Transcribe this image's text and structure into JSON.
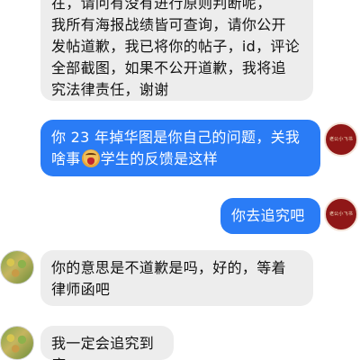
{
  "messages": [
    {
      "id": "m1",
      "direction": "incoming",
      "lines": [
        "所有海报战绩皆可查询，请你公开",
        "发帖道歉，我已将你的帖子，id，评论",
        "全部截图，如果不公开道歉，我将追",
        "究法律责任，谢谢"
      ],
      "cut_top_line": "在，请问有没有进行原则判断呢，",
      "prefix": "我"
    },
    {
      "id": "m2",
      "direction": "outgoing",
      "line1": "你 23 年掉华图是你自己的问题，关我",
      "line2_before_emoji": "啥事",
      "emoji": "angry-face-icon",
      "line2_after_emoji": "学生的反馈是这样"
    },
    {
      "id": "m3",
      "direction": "outgoing",
      "text": "你去追究吧"
    },
    {
      "id": "m4",
      "direction": "incoming",
      "line1": "你的意思是不道歉是吗，好的，等着",
      "line2": "律师函吧"
    },
    {
      "id": "m5",
      "direction": "incoming",
      "text": "我一定会追究到底"
    }
  ],
  "avatars": {
    "self_label": "老公小飞书",
    "other_label": "avatar"
  },
  "colors": {
    "incoming_bubble": "#ededed",
    "outgoing_bubble": "#2a7cf6",
    "self_avatar": "#8f1717"
  }
}
